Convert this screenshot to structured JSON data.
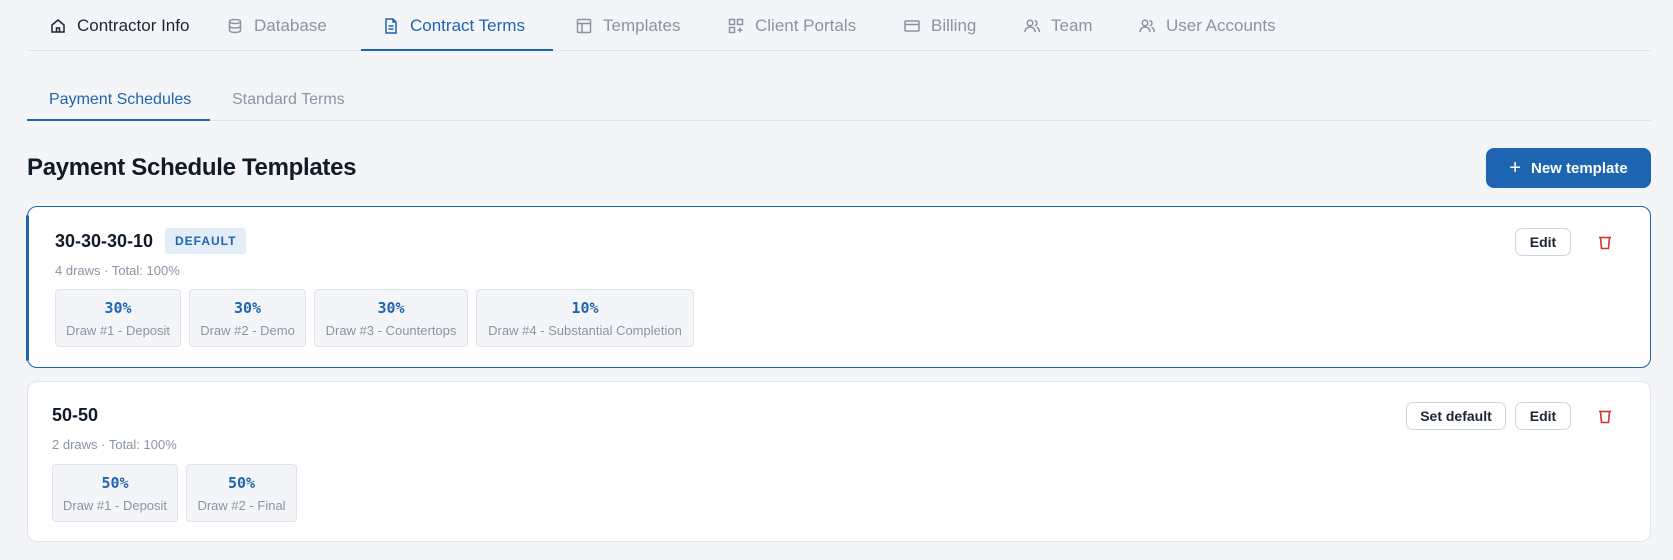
{
  "nav": {
    "tabs": [
      {
        "label": "Contractor Info",
        "icon": "home-icon"
      },
      {
        "label": "Database",
        "icon": "database-icon"
      },
      {
        "label": "Contract Terms",
        "icon": "document-icon"
      },
      {
        "label": "Templates",
        "icon": "layout-icon"
      },
      {
        "label": "Client Portals",
        "icon": "grid-plus-icon"
      },
      {
        "label": "Billing",
        "icon": "credit-card-icon"
      },
      {
        "label": "Team",
        "icon": "users-icon"
      },
      {
        "label": "User Accounts",
        "icon": "users-icon"
      }
    ],
    "active": "Contract Terms"
  },
  "subtabs": {
    "items": [
      "Payment Schedules",
      "Standard Terms"
    ],
    "active": "Payment Schedules"
  },
  "page": {
    "title": "Payment Schedule Templates",
    "new_button": "New template"
  },
  "templates": [
    {
      "name": "30-30-30-10",
      "badge": "DEFAULT",
      "meta": "4 draws · Total: 100%",
      "draws": [
        {
          "pct": "30%",
          "label": "Draw #1 - Deposit"
        },
        {
          "pct": "30%",
          "label": "Draw #2 - Demo"
        },
        {
          "pct": "30%",
          "label": "Draw #3 - Countertops"
        },
        {
          "pct": "10%",
          "label": "Draw #4 - Substantial Completion"
        }
      ],
      "edit_label": "Edit"
    },
    {
      "name": "50-50",
      "meta": "2 draws · Total: 100%",
      "draws": [
        {
          "pct": "50%",
          "label": "Draw #1 - Deposit"
        },
        {
          "pct": "50%",
          "label": "Draw #2 - Final"
        }
      ],
      "set_default_label": "Set default",
      "edit_label": "Edit"
    }
  ],
  "colors": {
    "accent": "#1d65b0",
    "danger": "#d0342c",
    "muted": "#8a94a3",
    "background": "#f4f5f8"
  }
}
